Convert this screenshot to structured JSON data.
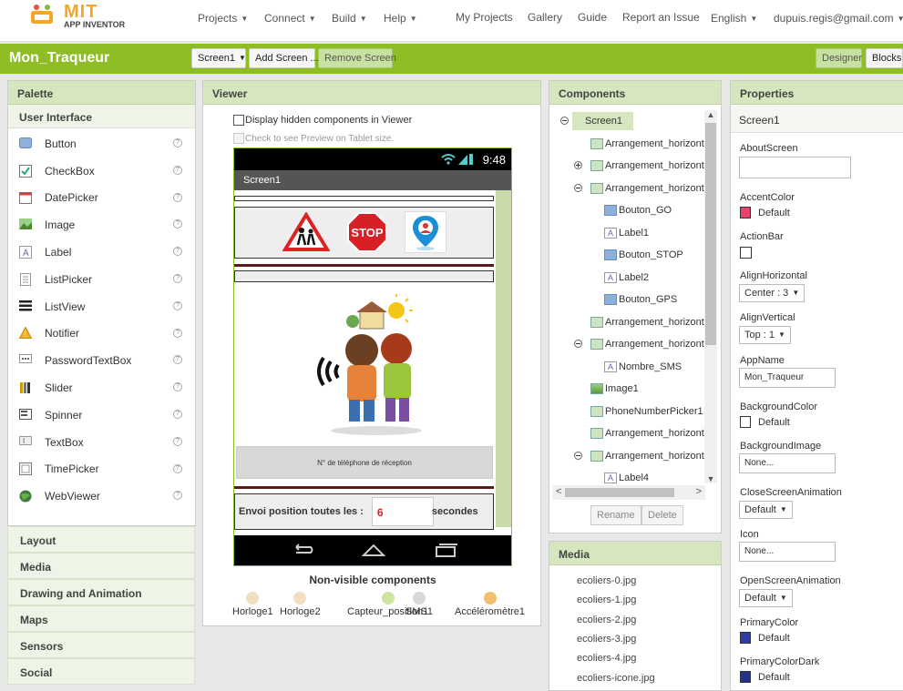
{
  "app": {
    "logo_title": "MIT",
    "logo_subtitle": "APP INVENTOR"
  },
  "topnav": {
    "menus": [
      {
        "label": "Projects"
      },
      {
        "label": "Connect"
      },
      {
        "label": "Build"
      },
      {
        "label": "Help"
      }
    ],
    "links": [
      {
        "label": "My Projects"
      },
      {
        "label": "Gallery"
      },
      {
        "label": "Guide"
      },
      {
        "label": "Report an Issue"
      }
    ],
    "language": "English",
    "user": "dupuis.regis@gmail.com"
  },
  "toolbar": {
    "project_name": "Mon_Traqueur",
    "screen_select": "Screen1",
    "add_screen": "Add Screen ...",
    "remove_screen": "Remove Screen",
    "designer": "Designer",
    "blocks": "Blocks"
  },
  "palette": {
    "title": "Palette",
    "section": "User Interface",
    "items": [
      {
        "label": "Button",
        "icon": "button-icon"
      },
      {
        "label": "CheckBox",
        "icon": "checkbox-icon"
      },
      {
        "label": "DatePicker",
        "icon": "datepicker-icon"
      },
      {
        "label": "Image",
        "icon": "image-icon"
      },
      {
        "label": "Label",
        "icon": "label-icon"
      },
      {
        "label": "ListPicker",
        "icon": "listpicker-icon"
      },
      {
        "label": "ListView",
        "icon": "listview-icon"
      },
      {
        "label": "Notifier",
        "icon": "notifier-icon"
      },
      {
        "label": "PasswordTextBox",
        "icon": "password-icon"
      },
      {
        "label": "Slider",
        "icon": "slider-icon"
      },
      {
        "label": "Spinner",
        "icon": "spinner-icon"
      },
      {
        "label": "TextBox",
        "icon": "textbox-icon"
      },
      {
        "label": "TimePicker",
        "icon": "timepicker-icon"
      },
      {
        "label": "WebViewer",
        "icon": "webviewer-icon"
      }
    ],
    "help_glyph": "?",
    "categories": [
      "Layout",
      "Media",
      "Drawing and Animation",
      "Maps",
      "Sensors",
      "Social"
    ]
  },
  "viewer": {
    "title": "Viewer",
    "show_hidden": "Display hidden components in Viewer",
    "tablet_preview": "Check to see Preview on Tablet size.",
    "phone": {
      "time": "9:48",
      "screen_title": "Screen1",
      "stop_text": "STOP",
      "phone_label": "N° de téléphone de réception",
      "send_label": "Envoi position toutes les :",
      "interval_value": "6",
      "seconds_label": "secondes"
    },
    "nonvisible_title": "Non-visible components",
    "nonvisible": [
      {
        "label": "Horloge1",
        "icon": "clock-icon"
      },
      {
        "label": "Horloge2",
        "icon": "clock-icon"
      },
      {
        "label": "Capteur_position1",
        "icon": "location-sensor-icon"
      },
      {
        "label": "SMS1",
        "icon": "sms-icon"
      },
      {
        "label": "Accéléromètre1",
        "icon": "accelerometer-icon"
      }
    ]
  },
  "components": {
    "title": "Components",
    "tree": [
      {
        "label": "Screen1",
        "depth": 0,
        "type": "screen",
        "toggle": "minus",
        "selected": true
      },
      {
        "label": "Arrangement_horizont",
        "depth": 1,
        "type": "arr",
        "toggle": ""
      },
      {
        "label": "Arrangement_horizont",
        "depth": 1,
        "type": "arr",
        "toggle": "plus"
      },
      {
        "label": "Arrangement_horizont",
        "depth": 1,
        "type": "arr",
        "toggle": "minus"
      },
      {
        "label": "Bouton_GO",
        "depth": 2,
        "type": "btn",
        "toggle": ""
      },
      {
        "label": "Label1",
        "depth": 2,
        "type": "lbl",
        "toggle": ""
      },
      {
        "label": "Bouton_STOP",
        "depth": 2,
        "type": "btn",
        "toggle": ""
      },
      {
        "label": "Label2",
        "depth": 2,
        "type": "lbl",
        "toggle": ""
      },
      {
        "label": "Bouton_GPS",
        "depth": 2,
        "type": "btn",
        "toggle": ""
      },
      {
        "label": "Arrangement_horizont",
        "depth": 1,
        "type": "arr",
        "toggle": ""
      },
      {
        "label": "Arrangement_horizont",
        "depth": 1,
        "type": "arr",
        "toggle": "minus"
      },
      {
        "label": "Nombre_SMS",
        "depth": 2,
        "type": "lbl",
        "toggle": ""
      },
      {
        "label": "Image1",
        "depth": 1,
        "type": "img",
        "toggle": ""
      },
      {
        "label": "PhoneNumberPicker1",
        "depth": 1,
        "type": "arr",
        "toggle": ""
      },
      {
        "label": "Arrangement_horizont",
        "depth": 1,
        "type": "arr",
        "toggle": ""
      },
      {
        "label": "Arrangement_horizont",
        "depth": 1,
        "type": "arr",
        "toggle": "minus"
      },
      {
        "label": "Label4",
        "depth": 2,
        "type": "lbl",
        "toggle": ""
      }
    ],
    "rename": "Rename",
    "delete": "Delete",
    "label_glyph": "A"
  },
  "media": {
    "title": "Media",
    "files": [
      "ecoliers-0.jpg",
      "ecoliers-1.jpg",
      "ecoliers-2.jpg",
      "ecoliers-3.jpg",
      "ecoliers-4.jpg",
      "ecoliers-icone.jpg"
    ]
  },
  "properties": {
    "title": "Properties",
    "component": "Screen1",
    "about_label": "AboutScreen",
    "about_value": "",
    "accent_label": "AccentColor",
    "accent_value": "Default",
    "accent_color": "#e8436b",
    "actionbar_label": "ActionBar",
    "alignh_label": "AlignHorizontal",
    "alignh_value": "Center : 3",
    "alignv_label": "AlignVertical",
    "alignv_value": "Top : 1",
    "appname_label": "AppName",
    "appname_value": "Mon_Traqueur",
    "bgcolor_label": "BackgroundColor",
    "bgcolor_value": "Default",
    "bgcolor_color": "#ffffff",
    "bgimage_label": "BackgroundImage",
    "bgimage_value": "None...",
    "closeanim_label": "CloseScreenAnimation",
    "closeanim_value": "Default",
    "icon_label": "Icon",
    "icon_value": "None...",
    "openanim_label": "OpenScreenAnimation",
    "openanim_value": "Default",
    "primary_label": "PrimaryColor",
    "primary_value": "Default",
    "primary_color": "#2d3ea8",
    "primarydark_label": "PrimaryColorDark",
    "primarydark_value": "Default",
    "primarydark_color": "#24338a"
  },
  "colors": {
    "brand_green": "#8fbd25",
    "panel_header": "#d6e6bf",
    "accent_orange": "#f5a623"
  }
}
